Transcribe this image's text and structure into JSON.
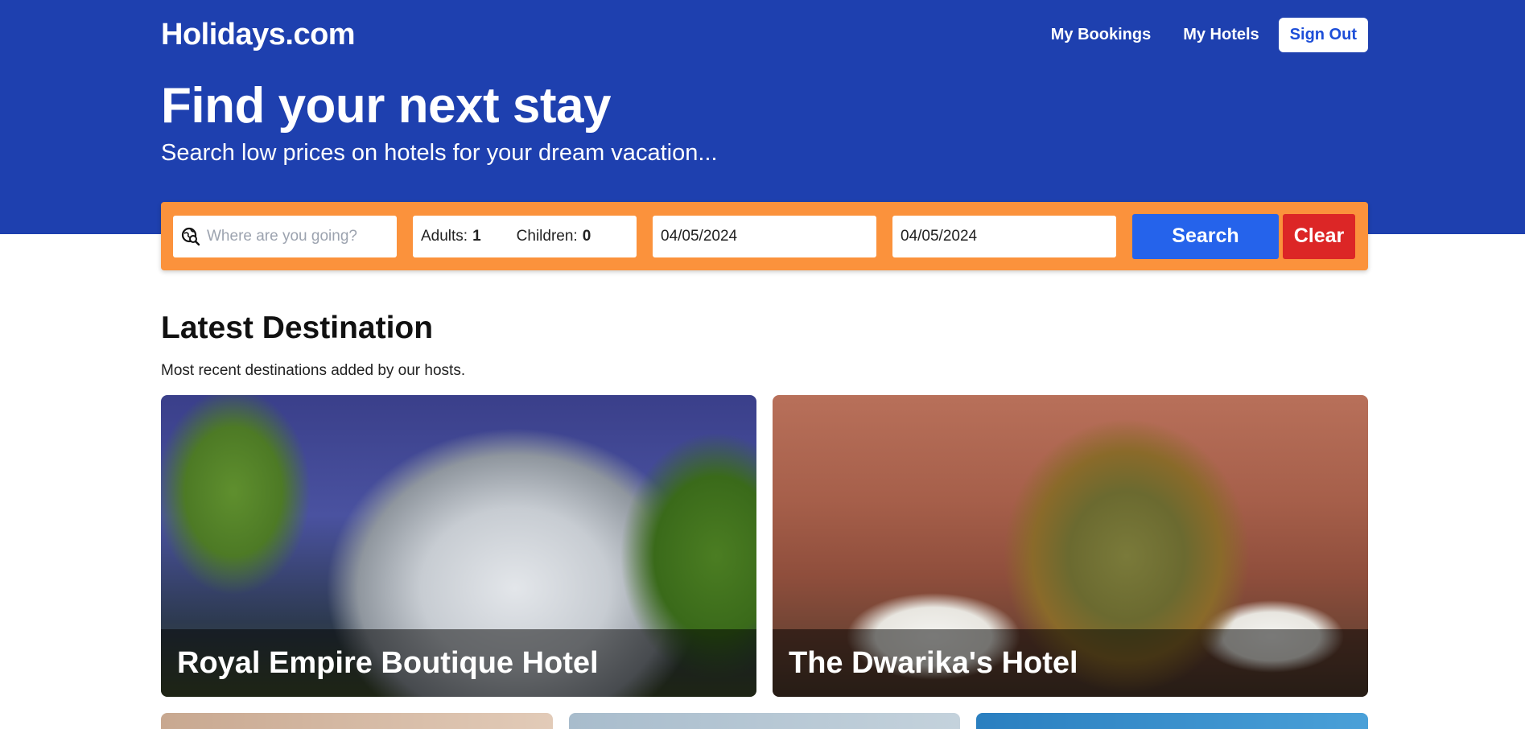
{
  "header": {
    "logo": "Holidays.com",
    "nav": {
      "my_bookings": "My Bookings",
      "my_hotels": "My Hotels",
      "sign_out": "Sign Out"
    }
  },
  "hero": {
    "title": "Find your next stay",
    "subtitle": "Search low prices on hotels for your dream vacation..."
  },
  "search": {
    "destination_placeholder": "Where are you going?",
    "destination_value": "",
    "adults_label": "Adults:",
    "adults_value": "1",
    "children_label": "Children:",
    "children_value": "0",
    "check_in": "04/05/2024",
    "check_out": "04/05/2024",
    "search_label": "Search",
    "clear_label": "Clear"
  },
  "latest": {
    "title": "Latest Destination",
    "subtitle": "Most recent destinations added by our hosts.",
    "cards": [
      {
        "name": "Royal Empire Boutique Hotel"
      },
      {
        "name": "The Dwarika's Hotel"
      }
    ]
  },
  "colors": {
    "primary": "#1e40af",
    "search_bar": "#fb923c",
    "search_button": "#2563eb",
    "clear_button": "#dc2626"
  },
  "icons": {
    "destination": "globe-search-icon"
  }
}
